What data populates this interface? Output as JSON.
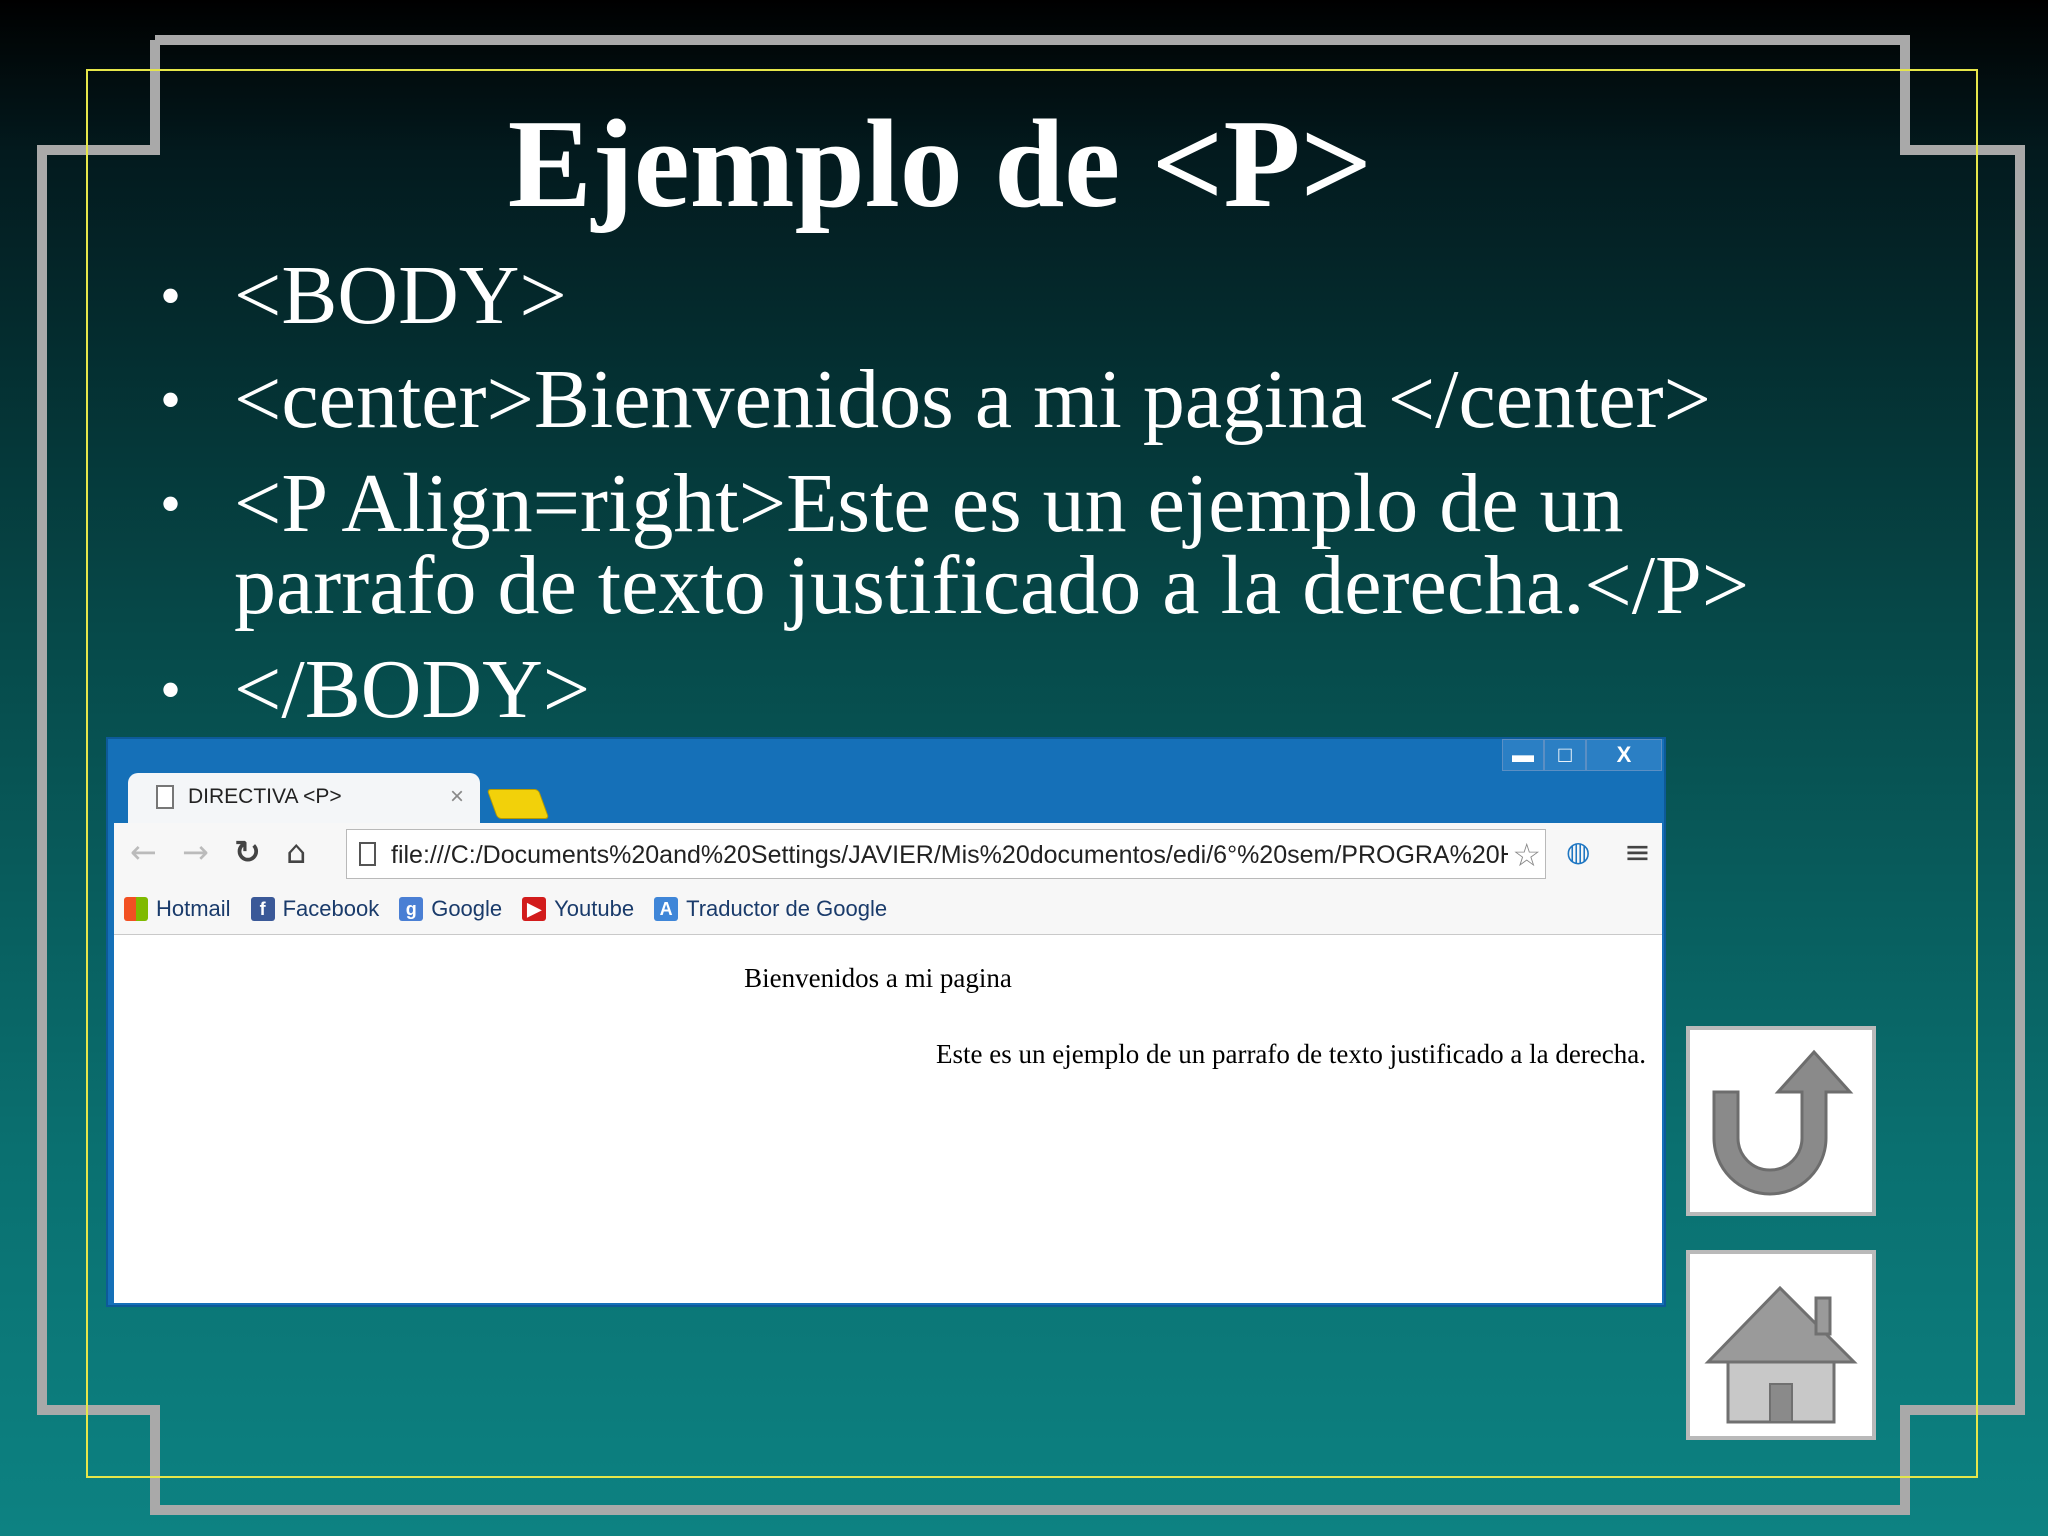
{
  "slide": {
    "title": "Ejemplo de <P>",
    "bullets": [
      "<BODY>",
      "<center>Bienvenidos a mi pagina </center>",
      "<P Align=right>Este es un ejemplo de un parrafo de texto justificado a la derecha.</P>",
      "</BODY>"
    ]
  },
  "browser": {
    "window_controls": {
      "minimize": "▬",
      "maximize": "□",
      "close": "X"
    },
    "tab": {
      "title": "DIRECTIVA <P>",
      "close": "×"
    },
    "toolbar": {
      "url": "file:///C:/Documents%20and%20Settings/JAVIER/Mis%20documentos/edi/6°%20sem/PROGRA%20H",
      "icons": [
        "back-icon",
        "forward-icon",
        "reload-icon",
        "home-icon",
        "star-icon",
        "extension-icon",
        "menu-icon"
      ]
    },
    "bookmarks": [
      {
        "label": "Hotmail",
        "icon": "windows-logo-icon"
      },
      {
        "label": "Facebook",
        "icon": "facebook-icon"
      },
      {
        "label": "Google",
        "icon": "google-icon"
      },
      {
        "label": "Youtube",
        "icon": "youtube-icon"
      },
      {
        "label": "Traductor de Google",
        "icon": "translate-icon"
      }
    ],
    "content": {
      "centered": "Bienvenidos a mi pagina",
      "right_aligned": "Este es un ejemplo de un parrafo de texto justificado a la derecha."
    }
  },
  "nav_buttons": {
    "back": "return-arrow-icon",
    "home": "house-icon"
  },
  "colors": {
    "frame": "#a9a9a9",
    "inner_frame": "#e6e64a",
    "browser_chrome": "#1570b8"
  }
}
